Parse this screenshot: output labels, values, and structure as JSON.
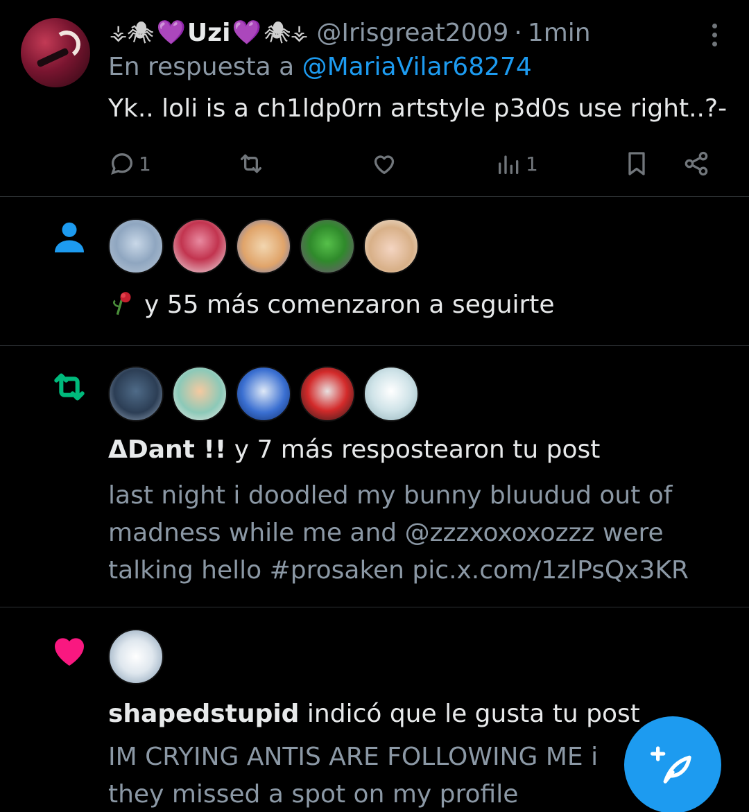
{
  "reply_tweet": {
    "name": "Uzi",
    "name_decor_left": "⚶🕷",
    "name_decor_right": "🕷⚶",
    "handle": "@Irisgreat2009",
    "separator": "·",
    "time": "1min",
    "replying_prefix": "En respuesta a",
    "replying_to": "@MariaVilar68274",
    "text": "Yk.. loli is a ch1ldp0rn artstyle p3d0s use right..?-",
    "actions": {
      "reply_count": "1",
      "retweet_count": "",
      "like_count": "",
      "views_count": "1"
    }
  },
  "follow_notification": {
    "icon": "person-icon",
    "avatar_count": 5,
    "text": "y 55 más comenzaron a seguirte"
  },
  "retweet_notification": {
    "icon": "retweet-icon",
    "actor": "ΔDant !!",
    "text": " y 7 más respostearon tu post",
    "preview": "last night i doodled my bunny bluudud out of madness while me and @zzzxoxoxozzz were talking hello #prosaken pic.x.com/1zlPsQx3KR"
  },
  "like_notification": {
    "icon": "heart-icon",
    "actor": "shapedstupid",
    "text": " indicó que le gusta tu post",
    "preview": "IM CRYING ANTIS ARE FOLLOWING ME i they missed a spot on my profile"
  },
  "fab": {
    "icon": "compose-feather-icon"
  },
  "colors": {
    "background": "#000000",
    "primary_text": "#e7e9ea",
    "secondary_text": "#8b98a5",
    "accent_blue": "#1d9bf0",
    "retweet_green": "#00ba7c",
    "like_pink": "#f91880",
    "divider": "#2f3336"
  }
}
